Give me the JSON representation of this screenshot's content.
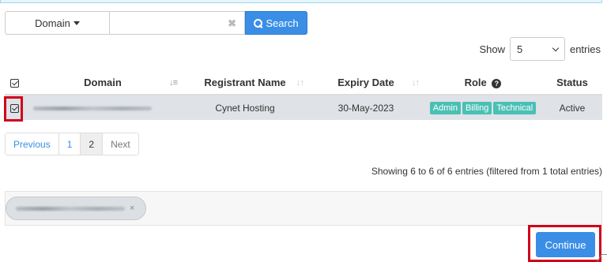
{
  "search": {
    "domain_label": "Domain",
    "input_value": "",
    "input_placeholder": "",
    "button_label": "Search",
    "clear_glyph": "✖"
  },
  "entries": {
    "show_label": "Show",
    "value": "5",
    "suffix": "entries"
  },
  "table": {
    "columns": [
      {
        "label": "",
        "sortable": false
      },
      {
        "label": "Domain",
        "sortable": true,
        "active": true
      },
      {
        "label": "Registrant Name",
        "sortable": true
      },
      {
        "label": "Expiry Date",
        "sortable": true
      },
      {
        "label": "Role",
        "help_icon": "question-circle-icon"
      },
      {
        "label": "Status"
      }
    ],
    "rows": [
      {
        "checked": true,
        "domain": "",
        "registrant": "Cynet Hosting",
        "expiry": "30-May-2023",
        "roles": [
          "Admin",
          "Billing",
          "Technical"
        ],
        "status": "Active"
      }
    ]
  },
  "pagination": {
    "prev": "Previous",
    "pages": [
      "1",
      "2"
    ],
    "current": "2",
    "next": "Next"
  },
  "info": "Showing 6 to 6 of 6 entries (filtered from 1 total entries)",
  "selected_chip": {
    "remove_glyph": "×"
  },
  "continue_label": "Continue",
  "colors": {
    "primary": "#3a8ee6",
    "badge": "#4ac0b5",
    "highlight": "#d0021b"
  }
}
